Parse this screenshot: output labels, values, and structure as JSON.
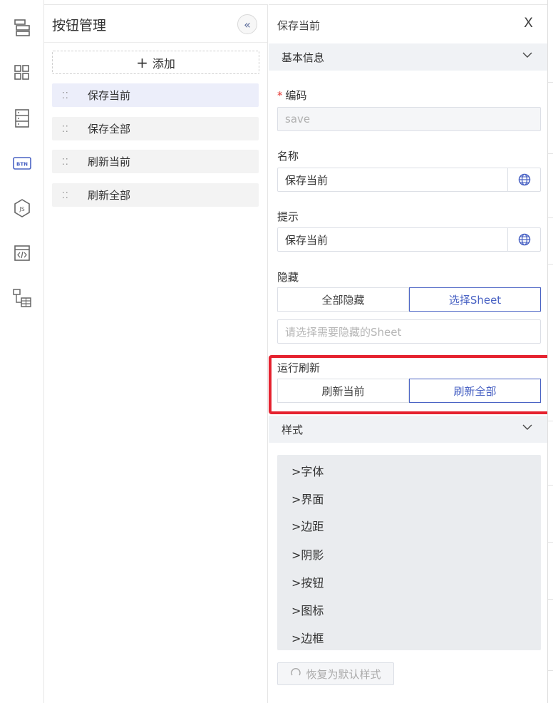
{
  "rail": {
    "items": [
      {
        "icon": "layout-icon"
      },
      {
        "icon": "grid-icon"
      },
      {
        "icon": "form-icon"
      },
      {
        "icon": "btn-icon",
        "text": "BTN"
      },
      {
        "icon": "js-icon",
        "text": "JS"
      },
      {
        "icon": "code-window-icon"
      },
      {
        "icon": "tree-table-icon"
      }
    ]
  },
  "list": {
    "title": "按钮管理",
    "collapse_symbol": "«",
    "add_label": "添加",
    "items": [
      {
        "label": "保存当前"
      },
      {
        "label": "保存全部"
      },
      {
        "label": "刷新当前"
      },
      {
        "label": "刷新全部"
      }
    ]
  },
  "prop": {
    "header": "保存当前",
    "close": "X",
    "basic_section": "基本信息",
    "code_label": "编码",
    "code_required": "*",
    "code_value": "save",
    "name_label": "名称",
    "name_value": "保存当前",
    "tip_label": "提示",
    "tip_value": "保存当前",
    "hide_label": "隐藏",
    "hide_options": [
      "全部隐藏",
      "选择Sheet"
    ],
    "hide_selected": "选择Sheet",
    "hide_placeholder": "请选择需要隐藏的Sheet",
    "refresh_label": "运行刷新",
    "refresh_options": [
      "刷新当前",
      "刷新全部"
    ],
    "refresh_selected": "刷新全部",
    "style_section": "样式",
    "style_items": [
      "字体",
      "界面",
      "边距",
      "阴影",
      "按钮",
      "图标",
      "边框"
    ],
    "reset_label": "恢复为默认样式"
  },
  "colors": {
    "accent": "#4a63c4",
    "highlight": "#e5222f",
    "selected_bg": "#eceefa"
  }
}
